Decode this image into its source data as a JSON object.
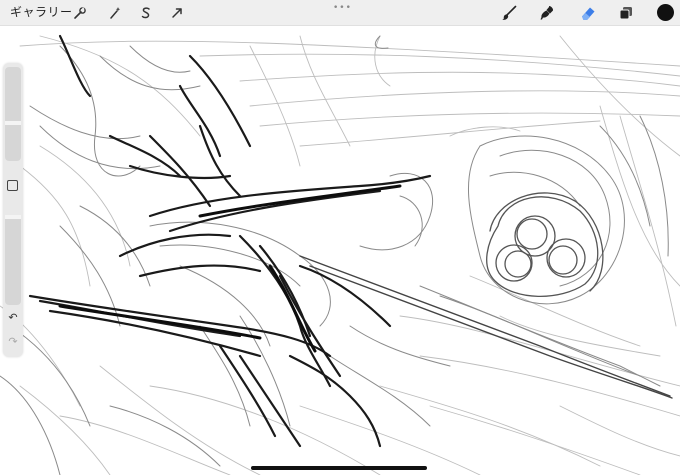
{
  "toolbar": {
    "gallery_label": "ギャラリー",
    "left_tools": [
      {
        "name": "wrench-icon"
      },
      {
        "name": "magic-wand-icon"
      },
      {
        "name": "selection-s-icon"
      },
      {
        "name": "transform-arrow-icon"
      }
    ],
    "more_dots": "•••",
    "right_tools": [
      {
        "name": "brush-icon"
      },
      {
        "name": "smudge-icon"
      },
      {
        "name": "eraser-icon",
        "active": true
      },
      {
        "name": "layers-icon"
      }
    ],
    "current_color": "#111111"
  },
  "sidebar": {
    "undo_glyph": "↶",
    "redo_glyph": "↷"
  },
  "colors": {
    "toolbar_bg": "#efefef",
    "canvas_bg": "#ffffff",
    "accent_active": "#3d7ee8",
    "ink": "#1a1a1a"
  }
}
